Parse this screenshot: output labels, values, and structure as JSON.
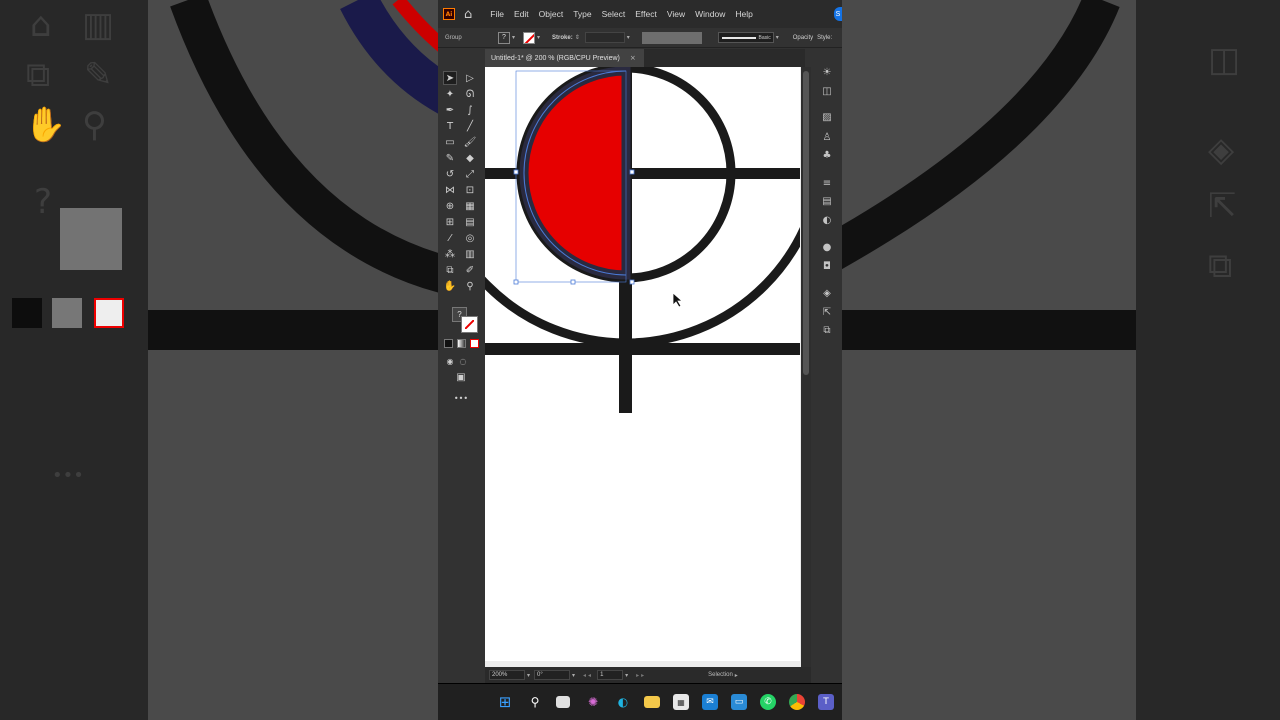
{
  "app": {
    "logo": "Ai",
    "menu": [
      "File",
      "Edit",
      "Object",
      "Type",
      "Select",
      "Effect",
      "View",
      "Window",
      "Help"
    ],
    "share_label": "S"
  },
  "control_bar": {
    "selection_type": "Group",
    "fill_box": "?",
    "stroke_label": "Stroke:",
    "brush_label": "Basic",
    "opacity_label": "Opacity",
    "style_label": "Style:"
  },
  "document_tab": {
    "title": "Untitled-1* @ 200 % (RGB/CPU Preview)",
    "close": "×"
  },
  "fill_stroke": {
    "fill_symbol": "?"
  },
  "status_bar": {
    "zoom": "200%",
    "rotation": "0°",
    "artboard_number": "1",
    "tool_status": "Selection"
  },
  "artwork": {
    "fill_color": "#e60000",
    "stroke_color": "#1a1a1a",
    "selection_color": "#4b7bd8"
  },
  "taskbar": {
    "icons": [
      "windows-start",
      "search",
      "task-view",
      "copilot",
      "edge",
      "file-explorer",
      "store",
      "mail",
      "remote-desktop",
      "whatsapp",
      "chrome",
      "teams"
    ]
  },
  "background_ghost": {
    "help_symbol": "?"
  }
}
